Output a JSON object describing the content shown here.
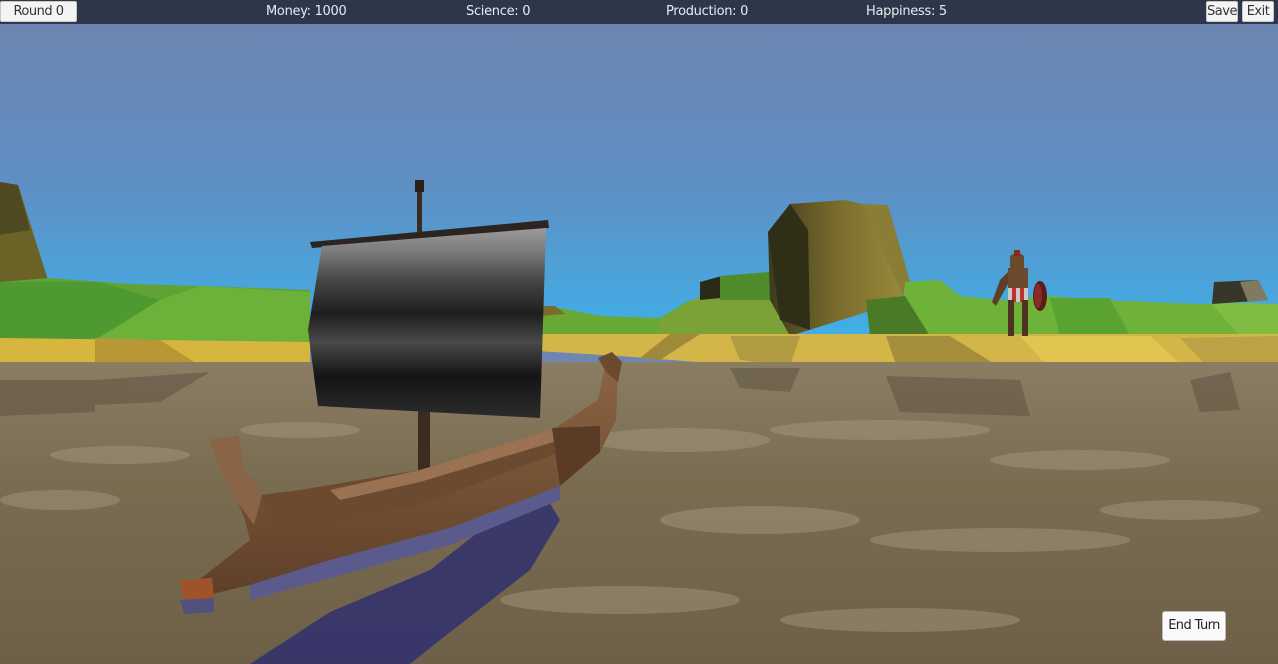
{
  "hud": {
    "round_label": "Round 0",
    "money_label": "Money: 1000",
    "science_label": "Science: 0",
    "production_label": "Production: 0",
    "happiness_label": "Happiness: 5",
    "save_label": "Save",
    "exit_label": "Exit"
  },
  "actions": {
    "end_turn_label": "End Turn"
  },
  "colors": {
    "hud_bar": "#1e2634",
    "sky_top": "#5e79a8",
    "sky_horizon": "#4aa6dc",
    "water": "#7d7055",
    "grass": "#5da834",
    "sand": "#d2b447",
    "hull": "#7a5234",
    "sail": "#3c3c3c"
  }
}
